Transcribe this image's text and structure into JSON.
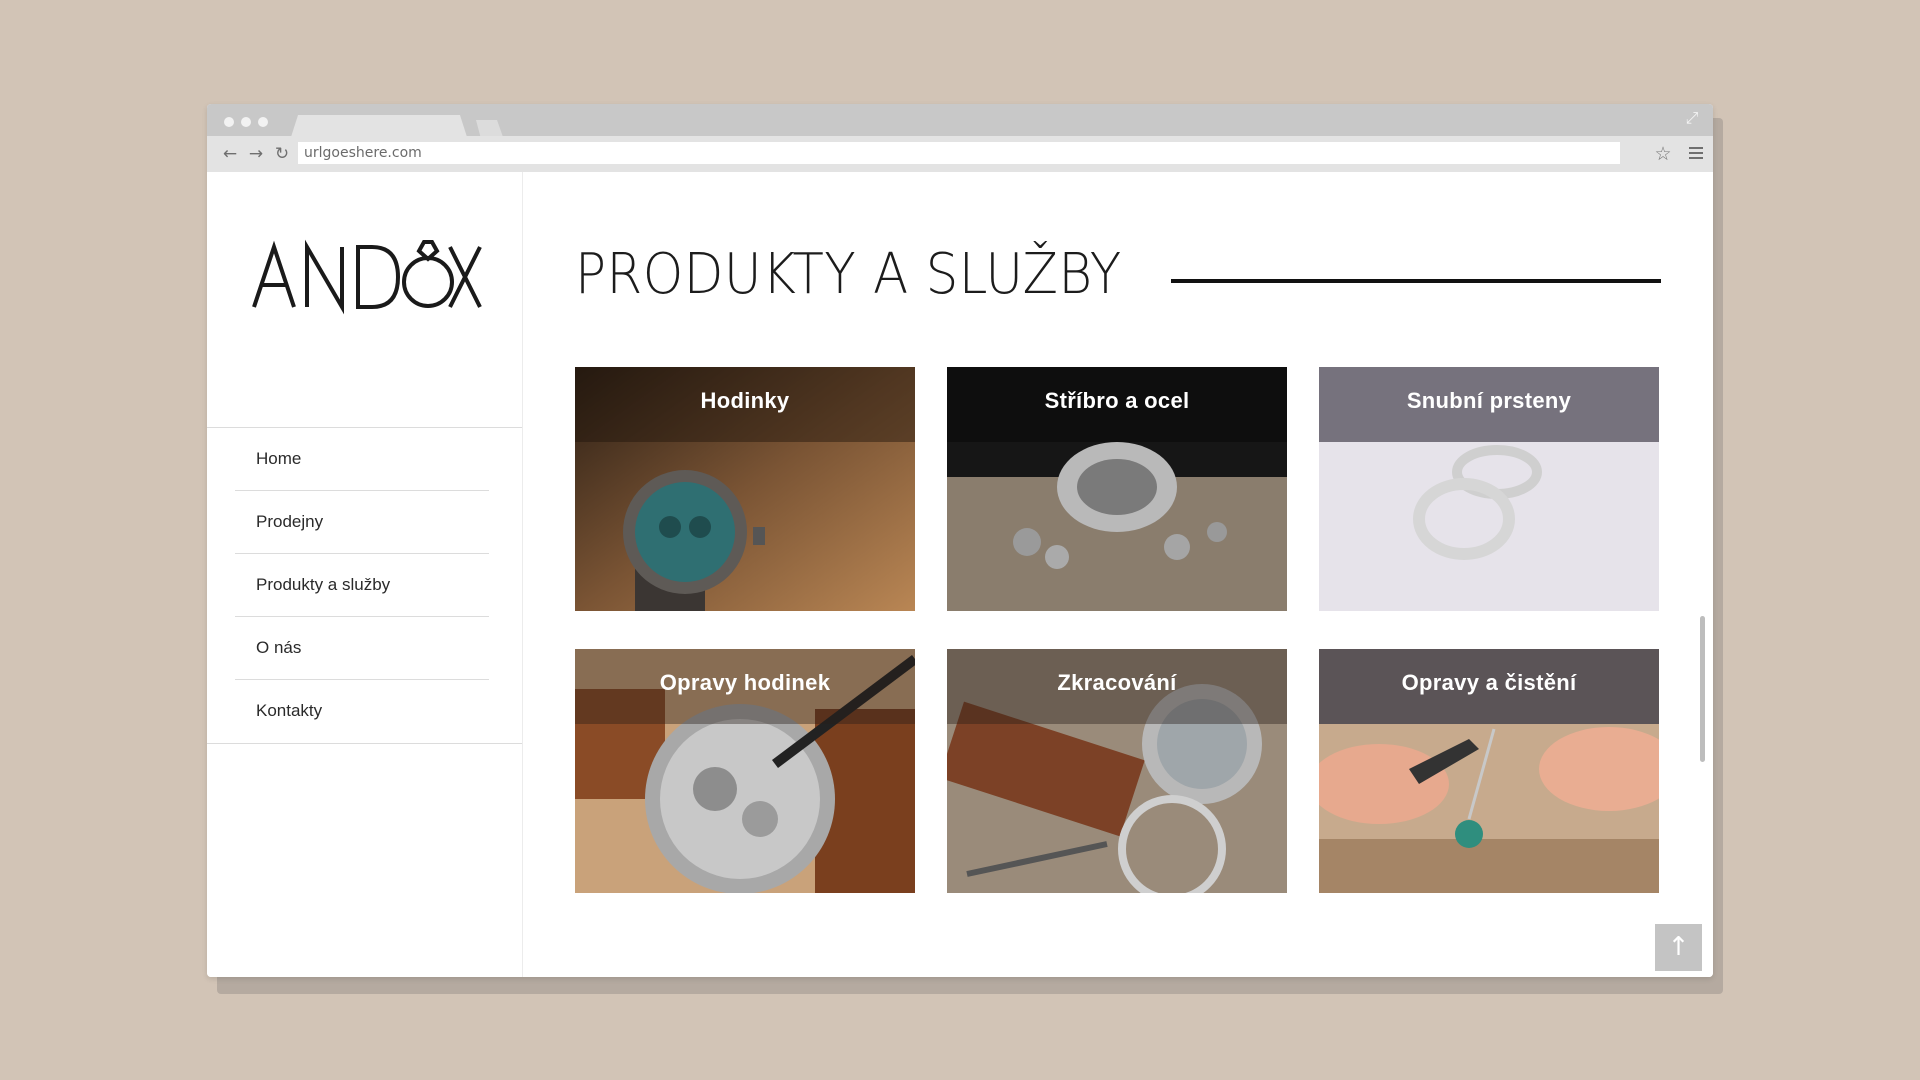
{
  "browser": {
    "url": "urlgoeshere.com",
    "icons": {
      "back": "arrow-left-icon",
      "forward": "arrow-right-icon",
      "reload": "reload-icon",
      "bookmark": "star-icon",
      "menu": "hamburger-menu-icon",
      "fullscreen": "expand-icon"
    }
  },
  "site": {
    "logo_text": "ANDOX",
    "nav": [
      {
        "label": "Home"
      },
      {
        "label": "Prodejny"
      },
      {
        "label": "Produkty a služby"
      },
      {
        "label": "O nás"
      },
      {
        "label": "Kontakty"
      }
    ]
  },
  "main": {
    "title": "PRODUKTY A SLUŽBY",
    "cards": [
      {
        "label": "Hodinky"
      },
      {
        "label": "Stříbro a ocel"
      },
      {
        "label": "Snubní prsteny"
      },
      {
        "label": "Opravy hodinek"
      },
      {
        "label": "Zkracování"
      },
      {
        "label": "Opravy a čistění"
      }
    ],
    "back_to_top": "↑"
  },
  "colors": {
    "background": "#d2c4b6",
    "text": "#1c1c1c",
    "caption_overlay": "rgba(0,0,0,0.45)"
  }
}
